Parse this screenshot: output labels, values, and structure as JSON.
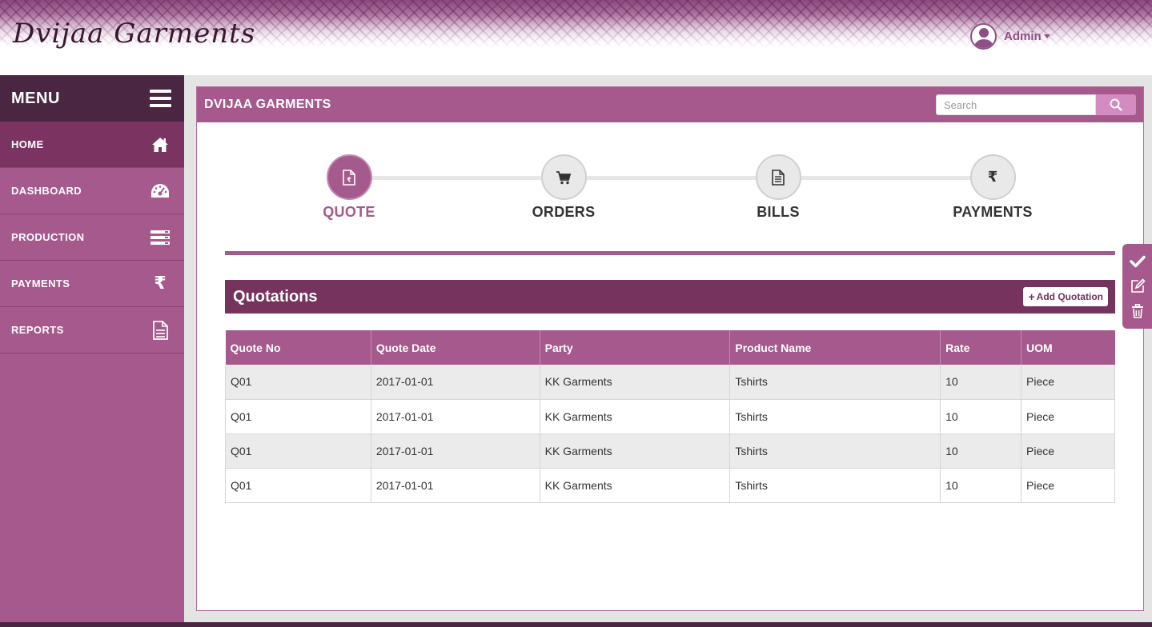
{
  "header": {
    "logo_text": "Dvijaa Garments",
    "user_name": "Admin"
  },
  "sidebar": {
    "menu_title": "MENU",
    "items": [
      {
        "label": "HOME",
        "icon": "home-icon",
        "active": true
      },
      {
        "label": "DASHBOARD",
        "icon": "dashboard-icon",
        "active": false
      },
      {
        "label": "PRODUCTION",
        "icon": "production-icon",
        "active": false
      },
      {
        "label": "PAYMENTS",
        "icon": "rupee-icon",
        "active": false
      },
      {
        "label": "REPORTS",
        "icon": "report-icon",
        "active": false
      }
    ]
  },
  "panel": {
    "title": "DVIJAA GARMENTS",
    "search_placeholder": "Search"
  },
  "steps": [
    {
      "label": "QUOTE",
      "icon": "quote-icon",
      "active": true
    },
    {
      "label": "ORDERS",
      "icon": "cart-icon",
      "active": false
    },
    {
      "label": "BILLS",
      "icon": "bill-icon",
      "active": false
    },
    {
      "label": "PAYMENTS",
      "icon": "rupee-icon",
      "active": false
    }
  ],
  "quotations": {
    "title": "Quotations",
    "add_label": "Add Quotation",
    "columns": [
      "Quote No",
      "Quote Date",
      "Party",
      "Product Name",
      "Rate",
      "UOM"
    ],
    "rows": [
      [
        "Q01",
        "2017-01-01",
        "KK Garments",
        "Tshirts",
        "10",
        "Piece"
      ],
      [
        "Q01",
        "2017-01-01",
        "KK Garments",
        "Tshirts",
        "10",
        "Piece"
      ],
      [
        "Q01",
        "2017-01-01",
        "KK Garments",
        "Tshirts",
        "10",
        "Piece"
      ],
      [
        "Q01",
        "2017-01-01",
        "KK Garments",
        "Tshirts",
        "10",
        "Piece"
      ]
    ]
  },
  "actions": [
    {
      "icon": "check-icon"
    },
    {
      "icon": "edit-icon"
    },
    {
      "icon": "trash-icon"
    }
  ],
  "colors": {
    "accent": "#a6598c",
    "accent_dark": "#76335d",
    "menu_head": "#4a2643"
  }
}
